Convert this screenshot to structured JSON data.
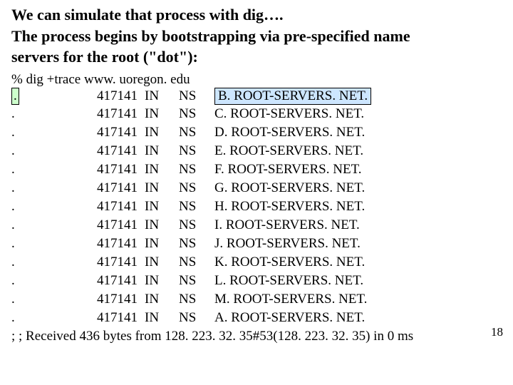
{
  "intro_lines": [
    "We can simulate that process with dig….",
    "The process begins by bootstrapping via pre-specified name",
    "servers for the root (\"dot\"):"
  ],
  "command": "% dig +trace www. uoregon. edu",
  "records": [
    {
      "name": ".",
      "ttl": "417141",
      "class": "IN",
      "type": "NS",
      "rdata": "B. ROOT-SERVERS. NET.",
      "hl_name": true,
      "hl_rdata": true
    },
    {
      "name": ".",
      "ttl": "417141",
      "class": "IN",
      "type": "NS",
      "rdata": "C. ROOT-SERVERS. NET.",
      "hl_name": false,
      "hl_rdata": false
    },
    {
      "name": ".",
      "ttl": "417141",
      "class": "IN",
      "type": "NS",
      "rdata": "D. ROOT-SERVERS. NET.",
      "hl_name": false,
      "hl_rdata": false
    },
    {
      "name": ".",
      "ttl": "417141",
      "class": "IN",
      "type": "NS",
      "rdata": "E. ROOT-SERVERS. NET.",
      "hl_name": false,
      "hl_rdata": false
    },
    {
      "name": ".",
      "ttl": "417141",
      "class": "IN",
      "type": "NS",
      "rdata": "F. ROOT-SERVERS. NET.",
      "hl_name": false,
      "hl_rdata": false
    },
    {
      "name": ".",
      "ttl": "417141",
      "class": "IN",
      "type": "NS",
      "rdata": "G. ROOT-SERVERS. NET.",
      "hl_name": false,
      "hl_rdata": false
    },
    {
      "name": ".",
      "ttl": "417141",
      "class": "IN",
      "type": "NS",
      "rdata": "H. ROOT-SERVERS. NET.",
      "hl_name": false,
      "hl_rdata": false
    },
    {
      "name": ".",
      "ttl": "417141",
      "class": "IN",
      "type": "NS",
      "rdata": "I. ROOT-SERVERS. NET.",
      "hl_name": false,
      "hl_rdata": false
    },
    {
      "name": ".",
      "ttl": "417141",
      "class": "IN",
      "type": "NS",
      "rdata": "J. ROOT-SERVERS. NET.",
      "hl_name": false,
      "hl_rdata": false
    },
    {
      "name": ".",
      "ttl": "417141",
      "class": "IN",
      "type": "NS",
      "rdata": "K. ROOT-SERVERS. NET.",
      "hl_name": false,
      "hl_rdata": false
    },
    {
      "name": ".",
      "ttl": "417141",
      "class": "IN",
      "type": "NS",
      "rdata": "L. ROOT-SERVERS. NET.",
      "hl_name": false,
      "hl_rdata": false
    },
    {
      "name": ".",
      "ttl": "417141",
      "class": "IN",
      "type": "NS",
      "rdata": "M. ROOT-SERVERS. NET.",
      "hl_name": false,
      "hl_rdata": false
    },
    {
      "name": ".",
      "ttl": "417141",
      "class": "IN",
      "type": "NS",
      "rdata": "A. ROOT-SERVERS. NET.",
      "hl_name": false,
      "hl_rdata": false
    }
  ],
  "footer": "; ; Received 436 bytes from 128. 223. 32. 35#53(128. 223. 32. 35) in 0 ms",
  "page_number": "18"
}
